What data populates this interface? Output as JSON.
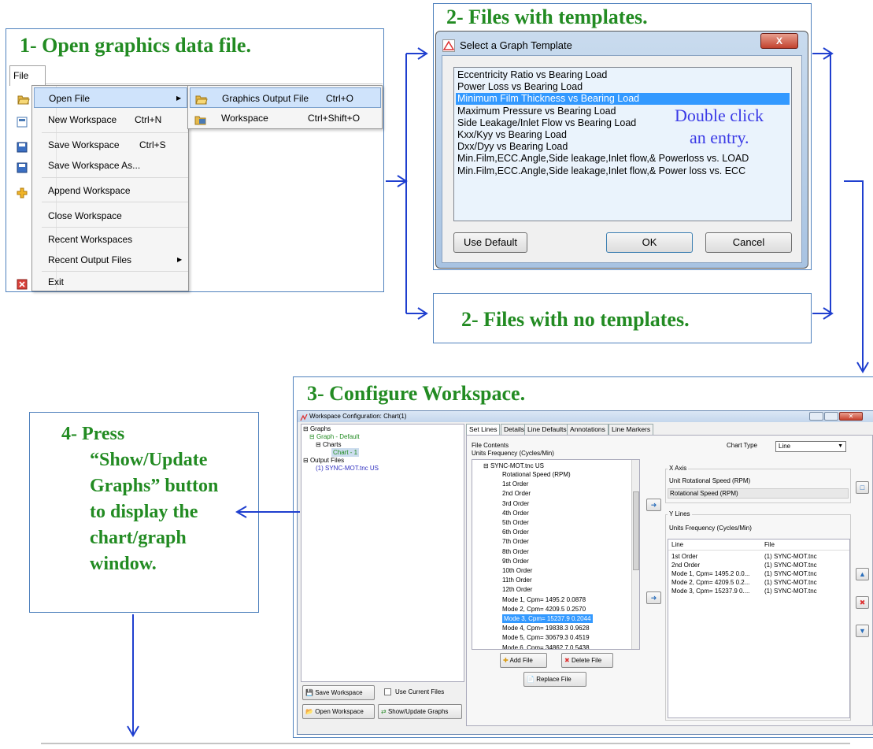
{
  "steps": {
    "s1": "1-  Open graphics data file.",
    "s2a": "2-  Files with templates.",
    "s2b": "2-  Files with no templates.",
    "s3": "3-  Configure Workspace.",
    "s4": "4-  Press “Show/Update Graphs” button to display the chart/graph window.",
    "s4_lines": [
      "4-  Press",
      "“Show/Update",
      "Graphs” button",
      "to display the",
      "chart/graph",
      "window."
    ]
  },
  "menu": {
    "bar_label": "File",
    "items": [
      {
        "label": "Open File",
        "shortcut": "",
        "icon": "folder-open-icon",
        "submenu": true,
        "highlighted": true
      },
      {
        "label": "New Workspace",
        "shortcut": "Ctrl+N",
        "icon": "new-workspace-icon"
      },
      {
        "label": "Save Workspace",
        "shortcut": "Ctrl+S",
        "icon": "save-icon"
      },
      {
        "label": "Save Workspace As...",
        "shortcut": "",
        "icon": "save-icon"
      },
      {
        "label": "Append Workspace",
        "shortcut": "",
        "icon": "plus-icon"
      },
      {
        "label": "Close Workspace",
        "shortcut": "",
        "icon": ""
      },
      {
        "label": "Recent Workspaces",
        "shortcut": "",
        "icon": ""
      },
      {
        "label": "Recent Output Files",
        "shortcut": "",
        "icon": "",
        "submenu": true
      },
      {
        "label": "Exit",
        "shortcut": "",
        "icon": "exit-icon"
      }
    ],
    "submenu": [
      {
        "label": "Graphics Output File",
        "shortcut": "Ctrl+O"
      },
      {
        "label": "Workspace",
        "shortcut": "Ctrl+Shift+O"
      }
    ]
  },
  "template_dialog": {
    "title": "Select a Graph Template",
    "close_label": "X",
    "items": [
      "Eccentricity Ratio vs Bearing Load",
      "Power Loss vs Bearing Load",
      "Minimum Film Thickness vs Bearing Load",
      "Maximum Pressure vs Bearing Load",
      "Side Leakage/Inlet Flow vs Bearing Load",
      "Kxx/Kyy vs Bearing Load",
      "Dxx/Dyy vs Bearing Load",
      "Min.Film,ECC.Angle,Side leakage,Inlet flow,& Powerloss vs. LOAD",
      "Min.Film,ECC.Angle,Side leakage,Inlet flow,& Power loss vs. ECC"
    ],
    "selected_index": 2,
    "hint_line1": "Double click",
    "hint_line2": "an  entry.",
    "buttons": {
      "use_default": "Use Default",
      "ok": "OK",
      "cancel": "Cancel"
    }
  },
  "workspace": {
    "title": "Workspace Configuration: Chart(1)",
    "tree": {
      "graphs": "Graphs",
      "graph_default": "Graph - Default",
      "charts": "Charts",
      "chart1": "Chart - 1",
      "output_files": "Output Files",
      "file1": "(1) SYNC-MOT.tnc US"
    },
    "tabs": [
      "Set Lines",
      "Details",
      "Line Defaults",
      "Annotations",
      "Line Markers"
    ],
    "file_contents_label": "File Contents",
    "units_label": "Units   Frequency (Cycles/Min)",
    "file_root": "SYNC-MOT.tnc US",
    "file_items": [
      "Rotational Speed (RPM)",
      "1st Order",
      "2nd Order",
      "3rd Order",
      "4th Order",
      "5th Order",
      "6th Order",
      "7th Order",
      "8th Order",
      "9th Order",
      "10th Order",
      "11th Order",
      "12th Order",
      "Mode 1, Cpm=  1495.2  0.0878",
      "Mode 2, Cpm=  4209.5  0.2570",
      "Mode 3, Cpm=  15237.9  0.2044",
      "Mode 4, Cpm=  19838.3  0.9628",
      "Mode 5, Cpm=  30679.3  0.4519",
      "Mode 6, Cpm=  34862.7  0.5438"
    ],
    "file_selected_index": 15,
    "chart_type_label": "Chart Type",
    "chart_type_value": "Line",
    "x_axis_label": "X Axis",
    "x_unit_label": "Unit    Rotational Speed (RPM)",
    "x_value": "Rotational Speed (RPM)",
    "y_lines_label": "Y Lines",
    "y_units_label": "Units  Frequency (Cycles/Min)",
    "y_headers": [
      "Line",
      "File"
    ],
    "y_rows": [
      [
        "1st Order",
        "(1) SYNC-MOT.tnc"
      ],
      [
        "2nd Order",
        "(1) SYNC-MOT.tnc"
      ],
      [
        "Mode 1, Cpm=  1495.2  0.0...",
        "(1) SYNC-MOT.tnc"
      ],
      [
        "Mode 2, Cpm=  4209.5  0.2...",
        "(1) SYNC-MOT.tnc"
      ],
      [
        "Mode 3, Cpm=  15237.9  0....",
        "(1) SYNC-MOT.tnc"
      ]
    ],
    "buttons": {
      "add_file": "Add File",
      "delete_file": "Delete File",
      "replace_file": "Replace File",
      "save_workspace": "Save Workspace",
      "use_current_files": "Use Current Files",
      "open_workspace": "Open Workspace",
      "show_update": "Show/Update Graphs"
    }
  },
  "colors": {
    "step_text": "#228b22",
    "connector": "#1f3fcf",
    "panel_border": "#4f81bd",
    "highlight": "#3399ff"
  }
}
